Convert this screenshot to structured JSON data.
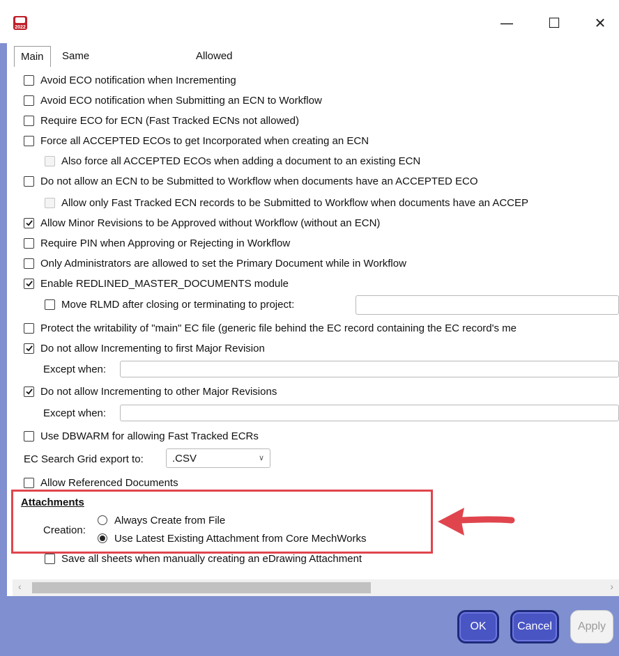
{
  "window": {
    "app_icon": "solidworks-pdm-2022-icon",
    "app_icon_text": "2022",
    "minimize": "—",
    "maximize": "☐",
    "close": "✕"
  },
  "tabs": [
    {
      "label": "Main",
      "active": true
    },
    {
      "label": "Same User Avoidance",
      "active": false
    },
    {
      "label": "Allowed To Avoid Workflow",
      "active": false
    }
  ],
  "options": [
    {
      "label": "Avoid ECO notification when Incrementing",
      "checked": false,
      "enabled": true
    },
    {
      "label": "Avoid ECO notification when Submitting an ECN to Workflow",
      "checked": false,
      "enabled": true
    },
    {
      "label": "Require ECO for ECN (Fast Tracked ECNs not allowed)",
      "checked": false,
      "enabled": true
    },
    {
      "label": "Force all ACCEPTED ECOs to get Incorporated when creating an ECN",
      "checked": false,
      "enabled": true
    },
    {
      "label": "Also force all ACCEPTED ECOs when adding a document to an existing ECN",
      "checked": false,
      "enabled": false
    },
    {
      "label": "Do not allow an ECN to be Submitted to Workflow when documents have an ACCEPTED ECO",
      "checked": false,
      "enabled": true
    },
    {
      "label": "Allow only Fast Tracked ECN records to be Submitted to Workflow when documents have an ACCEP",
      "checked": false,
      "enabled": false
    },
    {
      "label": "Allow Minor Revisions to be Approved without Workflow (without an ECN)",
      "checked": true,
      "enabled": true
    },
    {
      "label": "Require PIN when Approving or Rejecting in Workflow",
      "checked": false,
      "enabled": true
    },
    {
      "label": "Only Administrators are allowed to set the Primary Document while in Workflow",
      "checked": false,
      "enabled": true
    },
    {
      "label": "Enable REDLINED_MASTER_DOCUMENTS module",
      "checked": true,
      "enabled": true
    },
    {
      "label": "Move RLMD after closing or terminating to project:",
      "checked": false,
      "enabled": true
    },
    {
      "label": "Protect the writability of \"main\" EC file (generic file behind the EC record containing the EC record's me",
      "checked": false,
      "enabled": true
    },
    {
      "label": "Do not allow Incrementing to first Major Revision",
      "checked": true,
      "enabled": true
    },
    {
      "label": "Do not allow Incrementing to other Major Revisions",
      "checked": true,
      "enabled": true
    },
    {
      "label": "Use DBWARM for allowing Fast Tracked ECRs",
      "checked": false,
      "enabled": true
    },
    {
      "label": "Allow Referenced Documents",
      "checked": false,
      "enabled": true
    },
    {
      "label": "Save all sheets when manually creating an eDrawing Attachment",
      "checked": false,
      "enabled": true
    }
  ],
  "except_when_label": "Except when:",
  "except_when_1_value": "",
  "except_when_2_value": "",
  "rlmd_project_value": "",
  "export": {
    "label": "EC Search Grid export to:",
    "value": ".CSV"
  },
  "attachments": {
    "heading": "Attachments",
    "creation_label": "Creation:",
    "options": [
      {
        "label": "Always Create from File",
        "selected": false
      },
      {
        "label": "Use Latest Existing Attachment from Core MechWorks",
        "selected": true
      }
    ],
    "highlight_color": "#e0454d"
  },
  "scrollbar": {
    "left_arrow": "‹",
    "right_arrow": "›"
  },
  "buttons": {
    "ok": "OK",
    "cancel": "Cancel",
    "apply": "Apply"
  },
  "colors": {
    "footer": "#7f8fd0",
    "primary_button": "#4a55c4",
    "annotation_arrow": "#e0454d"
  }
}
